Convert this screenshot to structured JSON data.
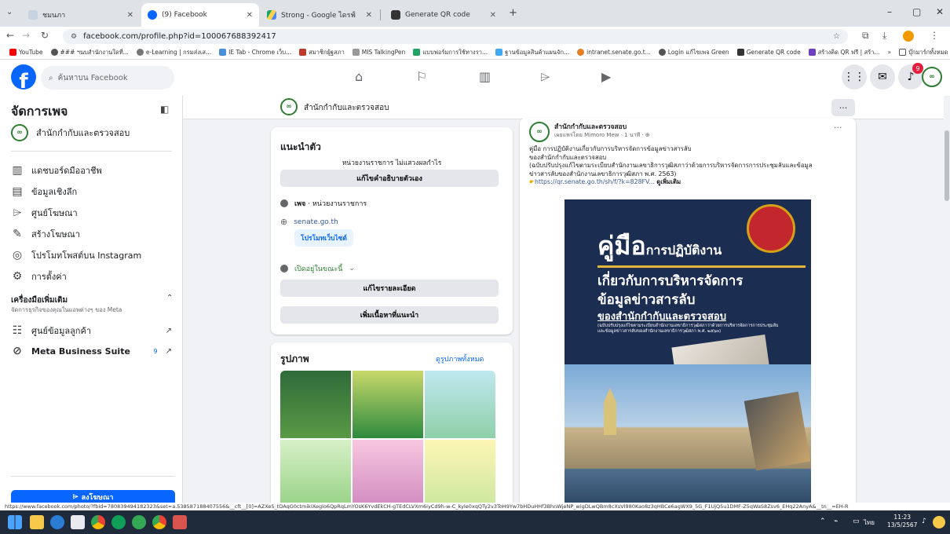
{
  "browser": {
    "tabs": [
      {
        "label": "ชมนภา",
        "active": false
      },
      {
        "label": "(9) Facebook",
        "active": true
      },
      {
        "label": "Strong - Google ไดรฟ์",
        "active": false
      },
      {
        "label": "Generate QR code",
        "active": false
      }
    ],
    "new_tab": "+",
    "url": "facebook.com/profile.php?id=100067688392417",
    "bookmarks": [
      "YouTube",
      "### ฯนบสำนักงานใดที่...",
      "e-Learning | กรมส่งเส...",
      "IE Tab - Chrome เว็บ...",
      "สมาชิกผู้ฐสภา",
      "MIS TalkingPen",
      "แบบฟอร์มการใช้ทางรา...",
      "ฐานข้อมูลสินค้าแผนจัก...",
      "intranet.senate.go.t...",
      "Login แก้ไขเพจ Green",
      "Generate QR code",
      "สร้างคิด QR ฟรี | สร้า..."
    ],
    "bookmarks_more": "»",
    "all_bookmarks": "บุ๊กมาร์กทั้งหมด"
  },
  "fb": {
    "logo": "f",
    "search_placeholder": "ค้นหาบน Facebook",
    "notif_count": "9"
  },
  "sidebar": {
    "title": "จัดการเพจ",
    "page_name": "สำนักกำกับและตรวจสอบ",
    "items": [
      {
        "label": "แดชบอร์ดมืออาชีพ",
        "icon": "▥"
      },
      {
        "label": "ข้อมูลเชิงลึก",
        "icon": "▤"
      },
      {
        "label": "ศูนย์โฆษณา",
        "icon": "⌲"
      },
      {
        "label": "สร้างโฆษณา",
        "icon": "✎"
      },
      {
        "label": "โปรโมทโพสต์บน Instagram",
        "icon": "◎"
      },
      {
        "label": "การตั้งค่า",
        "icon": "⚙"
      }
    ],
    "more_tools_title": "เครื่องมือเพิ่มเติม",
    "more_tools_sub": "จัดการธุรกิจของคุณในแอพต่างๆ ของ Meta",
    "tools": [
      {
        "label": "ศูนย์ข้อมูลลูกค้า",
        "badge": ""
      },
      {
        "label": "Meta Business Suite",
        "badge": "9"
      }
    ],
    "ad_button": "ลงโฆษณา"
  },
  "pagebar": {
    "name": "สำนักกำกับและตรวจสอบ",
    "more": "···"
  },
  "intro": {
    "title": "แนะนำตัว",
    "subtitle": "หน่วยงานราชการ ไม่แสวงผลกำไร",
    "edit_bio": "แก้ไขคำอธิบายตัวเอง",
    "category_bold": "เพจ",
    "category_rest": " · หน่วยงานราชการ",
    "website": "senate.go.th",
    "promote_site": "โปรโมทเว็บไซต์",
    "open_now": "เปิดอยู่ในขณะนี้",
    "edit_details": "แก้ไขรายละเอียด",
    "add_featured": "เพิ่มเนื้อหาที่แนะนำ"
  },
  "photos": {
    "title": "รูปภาพ",
    "see_all": "ดูรูปภาพทั้งหมด"
  },
  "post": {
    "author": "สำนักกำกับและตรวจสอบ",
    "meta": "เผยแพร่โดย Mimoro Mew · 1 นาที · ⊕",
    "line1": "คู่มือ การปฏิบัติงานเกี่ยวกับการบริหารจัดการข้อมูลข่าวสารลับ",
    "line2": "ของสำนักกำกับและตรวจสอบ",
    "line3": "(ฉบับปรับปรุงแก้ไขตามระเบียบสำนักงานเลขาธิการวุฒิสภาว่าด้วยการบริหารจัดการการประชุมลับและข้อมูล",
    "line4": "ข่าวสารลับของสำนักงานเลขาธิการวุฒิสภา พ.ศ. 2563)",
    "link": "https://qr.senate.go.th/sh/f/?k=828FV...",
    "see_more": "ดูเพิ่มเติม",
    "more": "···",
    "poster_big": "คู่มือ",
    "poster_small": "การปฏิบัติงาน",
    "poster_l2": "เกี่ยวกับการบริหารจัดการ",
    "poster_l3": "ข้อมูลข่าวสารลับ",
    "poster_l4": "ของสำนักกำกับและตรวจสอบ",
    "poster_note": "(ฉบับปรับปรุงแก้ไขตามระเบียบสำนักงานเลขาธิการวุฒิสภาว่าด้วยการบริหารจัดการการประชุมลับและข้อมูลข่าวสารลับของสำนักงานเลขาธิการวุฒิสภา พ.ศ. ๒๕๖๓)"
  },
  "status_url": "https://www.facebook.com/photo/?fbid=780839494182323&set=a.538587188407556&__cft__[0]=AZXeS_tOAqG0ctmikIXeglo6QpRqLmYOsK6YvdEkCH-gTEdCLVXm6iyCd9h-w-C_kyIe0xqQTy2v3ToH9Yw7bHDuHHf3BhnWjeNP_wigDLwQBm8cXsVI980Kao8z3qHBCe6agWX9_5G_F1UjQ5u1DMF-Z5qWaS8Zsv6_EHq22AnyA&__tn__=EH-R",
  "tray": {
    "time": "11:23",
    "date": "13/5/2567",
    "lang": "ไทย"
  },
  "colors": {
    "fb_blue": "#0866ff",
    "green": "#2e7d32",
    "navy": "#1c2d52",
    "red_badge": "#e41e3f"
  }
}
